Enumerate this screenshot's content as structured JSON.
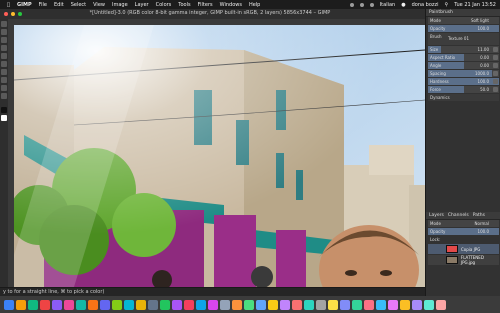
{
  "menubar": {
    "apple": "",
    "app_name": "GIMP",
    "items": [
      "File",
      "Edit",
      "Select",
      "View",
      "Image",
      "Layer",
      "Colors",
      "Tools",
      "Filters",
      "Windows",
      "Help"
    ],
    "input_source": "Italian",
    "user": "dona bozzi",
    "clock": "Tue 21 Jan 13:52"
  },
  "window": {
    "title": "*[Untitled]-3.0 (RGB color 8-bit gamma integer, GIMP built-in sRGB, 2 layers) 5856x3744 – GIMP"
  },
  "status": {
    "hint": "y to for a straight line, ⌘ to pick a color)"
  },
  "panel": {
    "paintbrush_tab": "Paintbrush",
    "mode_label": "Mode",
    "mode_value": "Soft light",
    "opacity_label": "Opacity",
    "opacity_value": "100.0",
    "brush_label": "Brush",
    "brush_name": "Texture 01",
    "options": [
      {
        "label": "Size",
        "value": "11.00",
        "fill": 0.18
      },
      {
        "label": "Aspect Ratio",
        "value": "0.00",
        "fill": 0.5
      },
      {
        "label": "Angle",
        "value": "0.00",
        "fill": 0.5
      },
      {
        "label": "Spacing",
        "value": "1000.0",
        "fill": 0.9
      },
      {
        "label": "Hardness",
        "value": "100.0",
        "fill": 1.0
      },
      {
        "label": "Force",
        "value": "50.0",
        "fill": 0.5
      }
    ],
    "dynamics_label": "Dynamics",
    "layers_tab": "Layers",
    "channels_tab": "Channels",
    "paths_tab": "Paths",
    "layers_mode_label": "Mode",
    "layers_mode_value": "Normal",
    "layers_opacity_label": "Opacity",
    "layers_opacity_value": "100.0",
    "lock_label": "Lock:",
    "layers": [
      {
        "name": "Copia JPG",
        "selected": true
      },
      {
        "name": "FLATTENED JPG.jpg",
        "selected": false
      }
    ]
  }
}
